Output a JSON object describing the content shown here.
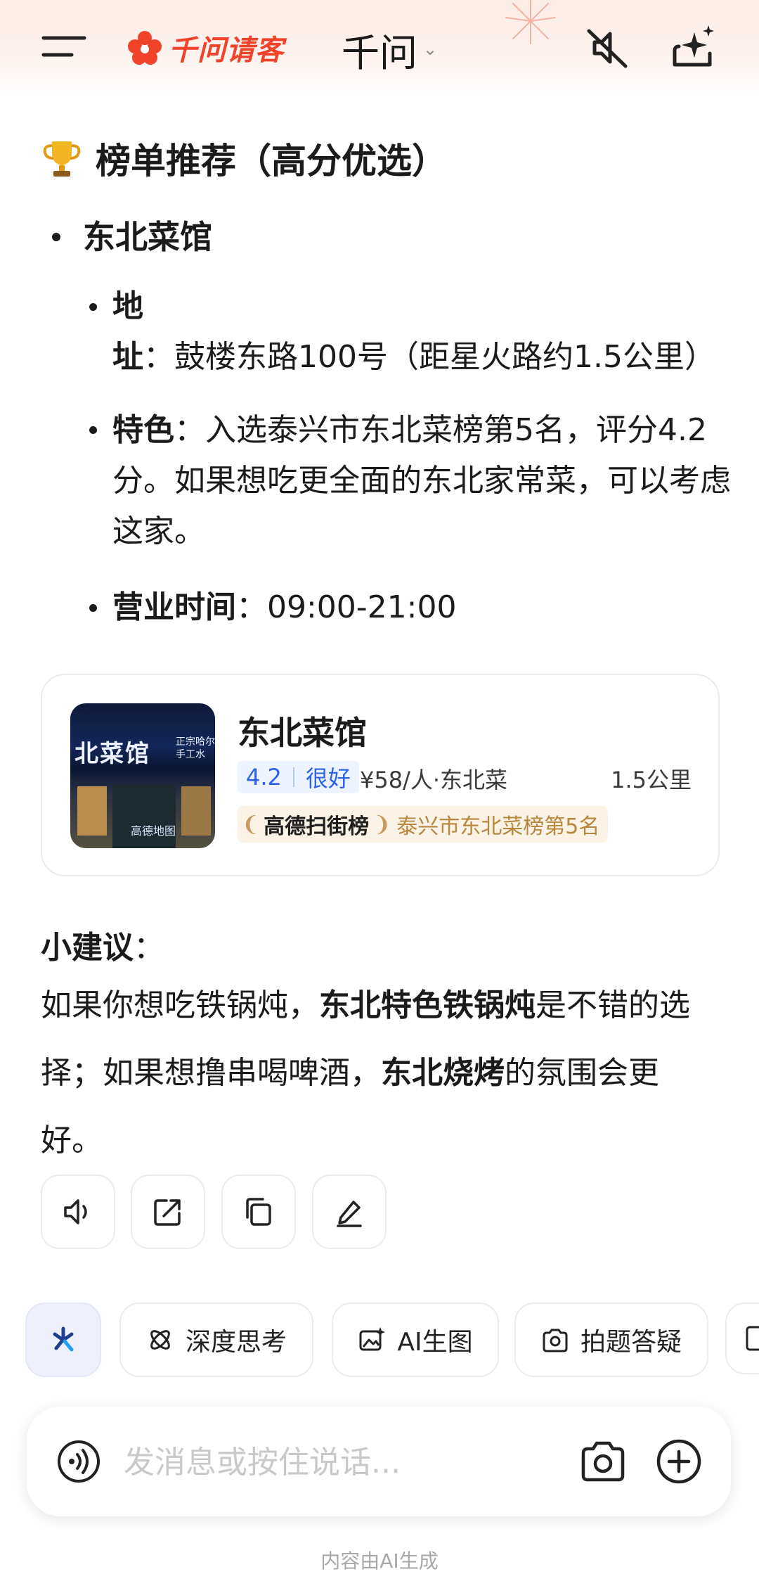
{
  "header": {
    "brand": "千问请客",
    "model_name": "千问",
    "model_chevron": "chevron-down-icon"
  },
  "section": {
    "icon": "trophy-icon",
    "title": "榜单推荐（高分优选）"
  },
  "restaurant": {
    "name": "东北菜馆",
    "address_label": "地址",
    "address_value": "：鼓楼东路100号（距星火路约1.5公里）",
    "feature_label": "特色",
    "feature_value": "：入选泰兴市东北菜榜第5名，评分4.2分。如果想吃更全面的东北家常菜，可以考虑这家。",
    "hours_label": "营业时间",
    "hours_value": "：09:00-21:00"
  },
  "card": {
    "title": "东北菜馆",
    "score": "4.2",
    "level": "很好",
    "price_cuisine": "¥58/人·东北菜",
    "distance": "1.5公里",
    "rank_brand": "高德扫街榜",
    "rank_text": "泰兴市东北菜榜第5名",
    "photo_sign": "北菜馆",
    "photo_sign_small_1": "正宗哈尔",
    "photo_sign_small_2": "手工水",
    "photo_watermark": "高德地图"
  },
  "tip": {
    "label": "小建议",
    "colon": "：",
    "part1": "如果你想吃铁锅炖，",
    "bold1": "东北特色铁锅炖",
    "part2": "是不错的选择；如果想撸串喝啤酒，",
    "bold2": "东北烧烤",
    "part3": "的氛围会更好。"
  },
  "actions": [
    {
      "icon": "speaker-icon"
    },
    {
      "icon": "share-icon"
    },
    {
      "icon": "copy-icon"
    },
    {
      "icon": "edit-icon"
    }
  ],
  "chips": {
    "first_icon": "sparkle-icon",
    "deep_think": "深度思考",
    "ai_image": "AI生图",
    "photo_qa": "拍题答疑"
  },
  "input": {
    "placeholder": "发消息或按住说话..."
  },
  "footer": {
    "note": "内容由AI生成"
  },
  "colors": {
    "brand_red": "#f0432a",
    "rating_blue": "#2d63e6",
    "rank_gold": "#b8863d"
  }
}
